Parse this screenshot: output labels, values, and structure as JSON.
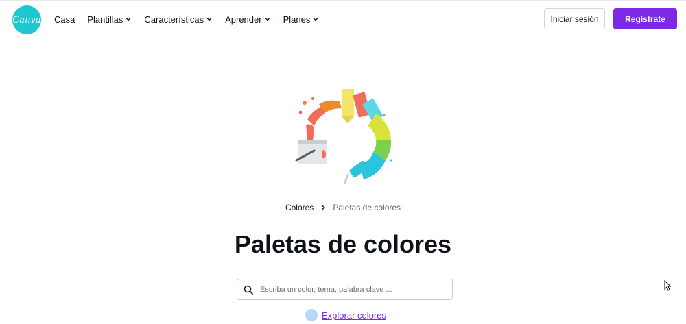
{
  "header": {
    "logo_text": "Canva",
    "menu": [
      {
        "label": "Casa",
        "dropdown": false
      },
      {
        "label": "Plantillas",
        "dropdown": true
      },
      {
        "label": "Características",
        "dropdown": true
      },
      {
        "label": "Aprender",
        "dropdown": true
      },
      {
        "label": "Planes",
        "dropdown": true
      }
    ],
    "login_label": "Iniciar sesión",
    "signup_label": "Regístrate"
  },
  "breadcrumb": {
    "parent": "Colores",
    "current": "Paletas de colores"
  },
  "page_title": "Paletas de colores",
  "search": {
    "placeholder": "Escriba un color, tema, palabra clave ..."
  },
  "explore_label": "Explorar colores",
  "colors": {
    "brand_purple": "#7d2ae8",
    "logo_teal": "#1ec8d2",
    "explore_dot": "#b5d9f5"
  }
}
